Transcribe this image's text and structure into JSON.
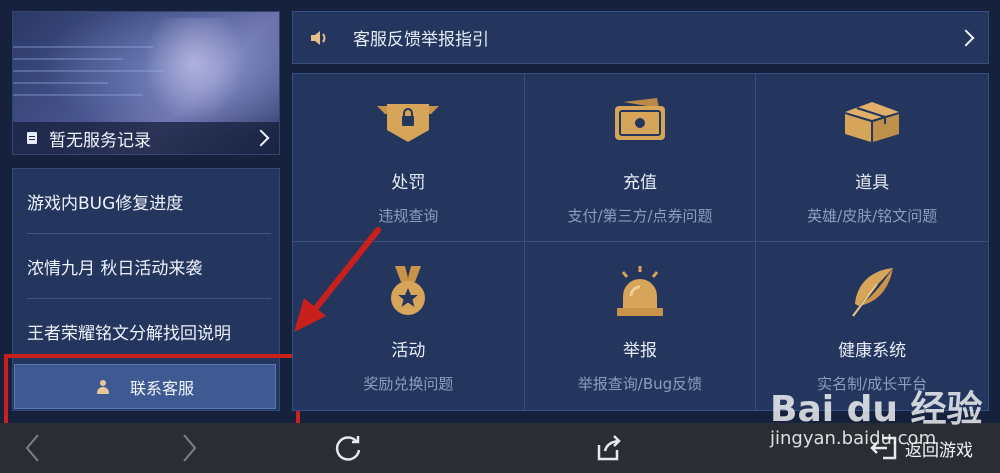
{
  "sidebar": {
    "service_record": "暂无服务记录",
    "news": [
      "游戏内BUG修复进度",
      "浓情九月 秋日活动来袭",
      "王者荣耀铭文分解找回说明"
    ],
    "contact_button": "联系客服"
  },
  "guide": {
    "label": "客服反馈举报指引"
  },
  "services": [
    {
      "title": "处罚",
      "subtitle": "违规查询",
      "icon": "shield-lock-icon"
    },
    {
      "title": "充值",
      "subtitle": "支付/第三方/点券问题",
      "icon": "wallet-icon"
    },
    {
      "title": "道具",
      "subtitle": "英雄/皮肤/铭文问题",
      "icon": "box-icon"
    },
    {
      "title": "活动",
      "subtitle": "奖励兑换问题",
      "icon": "medal-icon"
    },
    {
      "title": "举报",
      "subtitle": "举报查询/Bug反馈",
      "icon": "alarm-light-icon"
    },
    {
      "title": "健康系统",
      "subtitle": "实名制/成长平台",
      "icon": "feather-icon"
    }
  ],
  "bottom_nav": {
    "return_label": "返回游戏"
  },
  "watermark": {
    "logo": "Bai du 经验",
    "url": "jingyan.baidu.com"
  },
  "colors": {
    "background": "#16223d",
    "panel": "#24365e",
    "icon_gold": "#d6a55a",
    "highlight_red": "#c9201c",
    "contact_button": "#3f5a93"
  }
}
